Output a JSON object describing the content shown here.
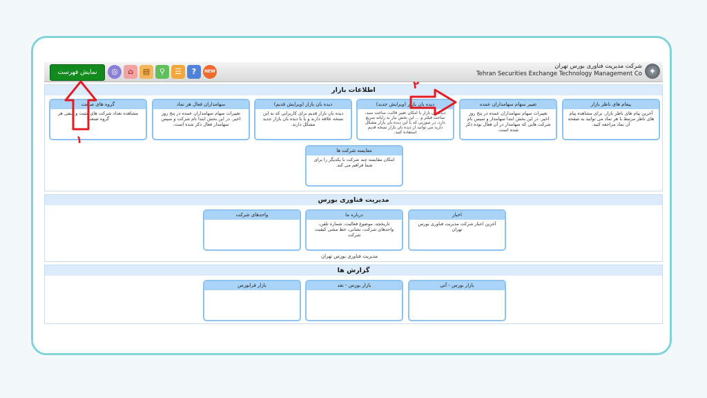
{
  "header": {
    "company_fa": "شرکت مدیریت فناوری بورس تهران",
    "company_en": "Tehran Securities Exchange Technology Management  Co",
    "menu_button": "نمایش فهرست"
  },
  "toolbar": {
    "icons": [
      "globe-icon",
      "home-icon",
      "table-icon",
      "search-icon",
      "message-icon",
      "help-icon",
      "new-icon"
    ],
    "new_badge": "NEW",
    "help_glyph": "?"
  },
  "market_info": {
    "title": "اطلاعات بازار",
    "cards": [
      {
        "title": "پیغام های ناظر بازار",
        "desc": "آخرین پیام های ناظر بازار. برای مشاهده پیام های ناظر مرتبط با هر نماد می توانید به صفحه آن نماد مراجعه کنید."
      },
      {
        "title": "تغییر سهام سهامداران عمده",
        "desc": "تغییرات سهام سهامداران عمده در پنج روز اخیر. در این بخش ابتدا سهامدار و سپس نام شرکت هایی که سهامدار در آن فعال بوده ذکر شده است."
      },
      {
        "title": "دیده بان بازار (ویرایش جدید)",
        "desc": "دیده بان بازار با امکان تغییر قالب، ساخت سبد، ساخت فیلتر و ... این بخش نیاز به رایانه سریع دارد. در صورتی که با این دیده بان بازار مشکل دارید می توانید از دیده بان بازار نسخه قدیم استفاده کنید."
      },
      {
        "title": "دیده بان بازار (ویرایش قدیم)",
        "desc": "دیده بان بازار قدیم برای کاربرانی که به این نسخه علاقه دارند و یا با دیده بان بازار جدید مشکل دارند."
      },
      {
        "title": "سهامداران فعال هر نماد",
        "desc": "تغییرات سهام سهامداران عمده در پنج روز اخیر. در این بخش ابتدا نام شرکت و سپس سهامدار فعال ذکر شده است."
      },
      {
        "title": "گروه های صنعت",
        "desc": "مشاهده تعداد شرکت های مثبت و منفی هر گروه صنعت"
      },
      {
        "title": "مقایسه شرکت ها",
        "desc": "امکان مقایسه چند شرکت با یکدیگر را برای شما فراهم می کند."
      }
    ]
  },
  "tech_mgmt": {
    "title": "مدیریت فناوری بورس",
    "cards": [
      {
        "title": "اخبار",
        "desc": "آخرین اخبار شرکت مدیریت فناوری بورس تهران"
      },
      {
        "title": "درباره ما",
        "desc": "تاریخچه، موضوع فعالیت، شماره تلفن، واحدهای شرکت، نشانی، خط مشی کیفیت شرکت"
      },
      {
        "title": "واحدهای شرکت",
        "desc": ""
      }
    ],
    "footer_note": "مدیریت فناوری بورس تهران"
  },
  "reports": {
    "title": "گزارش ها",
    "cards": [
      {
        "title": "بازار بورس - آتی",
        "desc": ""
      },
      {
        "title": "بازار بورس - نقد",
        "desc": ""
      },
      {
        "title": "بازار فرابورس",
        "desc": ""
      }
    ]
  },
  "annotations": {
    "one": "۱",
    "two": "۲"
  },
  "colors": {
    "accent_green": "#138a1e",
    "card_border": "#8ec3ef",
    "annotation_red": "#e31b23",
    "frame": "#7fd3d9"
  }
}
